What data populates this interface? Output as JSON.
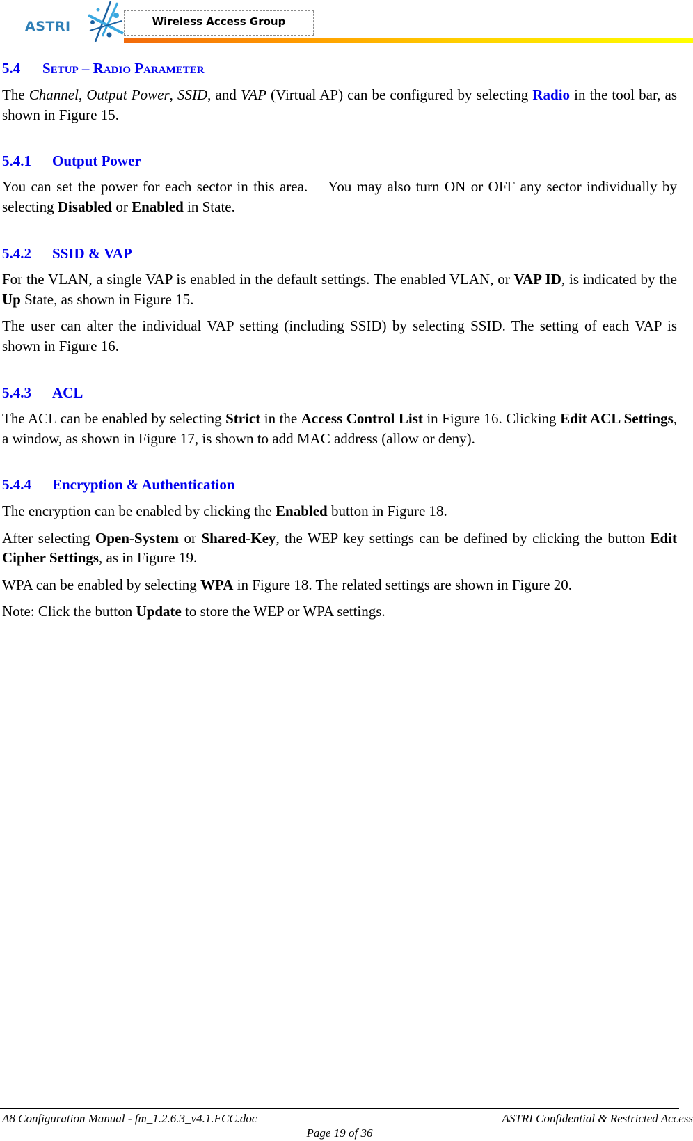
{
  "header": {
    "logo_text": "ASTRI",
    "group_label": "Wireless Access Group",
    "colors": {
      "logo_blue": "#2f7fb6",
      "bar_start": "#f26a0c",
      "bar_end": "#ffff00",
      "heading_blue": "#0000ee"
    }
  },
  "section": {
    "number": "5.4",
    "title": "Setup – Radio Parameter",
    "intro": {
      "t1": "The ",
      "i1": "Channel",
      "t2": ", ",
      "i2": "Output Power",
      "t3": ", ",
      "i3": "SSID",
      "t4": ", and ",
      "i4": "VAP",
      "t5": " (Virtual AP) can be configured by selecting ",
      "b1": "Radio",
      "t6": " in the tool bar, as shown in Figure 15."
    }
  },
  "subsections": [
    {
      "number": "5.4.1",
      "title": "Output Power",
      "p1": {
        "t1": "You can set the power for each sector in this area.    You may also turn ON or OFF any sector individually by selecting ",
        "b1": "Disabled",
        "t2": " or ",
        "b2": "Enabled",
        "t3": " in State."
      }
    },
    {
      "number": "5.4.2",
      "title": "SSID & VAP",
      "p1": {
        "t1": "For the VLAN, a single VAP is enabled in the default settings. The enabled VLAN, or ",
        "b1": "VAP ID",
        "t2": ", is indicated by the ",
        "b2": "Up",
        "t3": " State, as shown in Figure 15."
      },
      "p2": {
        "t1": "The user can alter the individual VAP setting (including SSID) by selecting SSID. The setting of each VAP is shown in Figure 16."
      }
    },
    {
      "number": "5.4.3",
      "title": "ACL",
      "p1": {
        "t1": "The ACL can be enabled by selecting ",
        "b1": "Strict",
        "t2": " in the ",
        "b2": "Access Control List",
        "t3": " in Figure 16. Clicking ",
        "b3": "Edit ACL Settings",
        "t4": ", a window, as shown in Figure 17, is shown to add MAC address (allow or deny)."
      }
    },
    {
      "number": "5.4.4",
      "title": "Encryption & Authentication",
      "p1": {
        "t1": "The encryption can be enabled by clicking the ",
        "b1": "Enabled",
        "t2": " button in Figure 18."
      },
      "p2": {
        "t1": "After selecting ",
        "b1": "Open-System",
        "t2": " or ",
        "b2": "Shared-Key",
        "t3": ", the WEP key settings can be defined by clicking the button ",
        "b3": "Edit Cipher Settings",
        "t4": ", as in Figure 19."
      },
      "p3": {
        "t1": "WPA can be enabled by selecting ",
        "b1": "WPA",
        "t2": " in Figure 18. The related settings are shown in Figure 20."
      },
      "p4": {
        "t1": "Note: Click the button ",
        "b1": "Update",
        "t2": " to store the WEP or WPA settings."
      }
    }
  ],
  "footer": {
    "left": "A8 Configuration Manual - fm_1.2.6.3_v4.1.FCC.doc",
    "right": "ASTRI Confidential & Restricted Access",
    "page": "Page 19 of 36"
  }
}
